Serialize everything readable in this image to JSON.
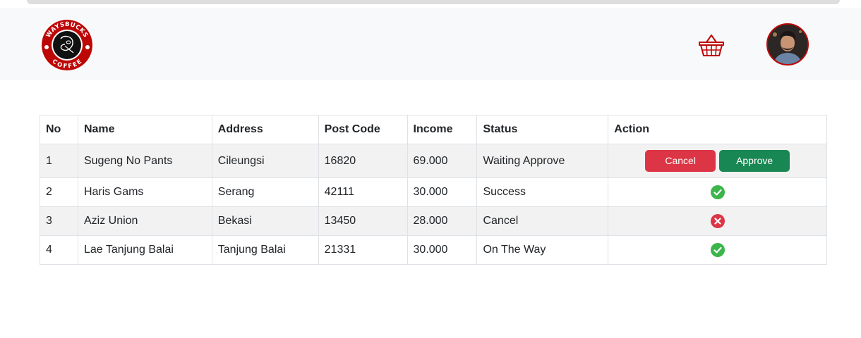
{
  "brand": {
    "logo_alt": "WAYSBUCKS COFFEE",
    "logo_text_top": "WAYSBUCKS",
    "logo_text_bottom": "COFFEE",
    "color": "#bd0707"
  },
  "navbar": {
    "cart_icon": "basket-icon",
    "avatar_icon": "user-avatar"
  },
  "table": {
    "headers": [
      "No",
      "Name",
      "Address",
      "Post Code",
      "Income",
      "Status",
      "Action"
    ],
    "rows": [
      {
        "no": "1",
        "name": "Sugeng No Pants",
        "address": "Cileungsi",
        "post_code": "16820",
        "income": "69.000",
        "status": "Waiting Approve",
        "action": "buttons"
      },
      {
        "no": "2",
        "name": "Haris Gams",
        "address": "Serang",
        "post_code": "42111",
        "income": "30.000",
        "status": "Success",
        "action": "success"
      },
      {
        "no": "3",
        "name": "Aziz Union",
        "address": "Bekasi",
        "post_code": "13450",
        "income": "28.000",
        "status": "Cancel",
        "action": "cancel"
      },
      {
        "no": "4",
        "name": "Lae Tanjung Balai",
        "address": "Tanjung Balai",
        "post_code": "21331",
        "income": "30.000",
        "status": "On The Way",
        "action": "success"
      }
    ],
    "buttons": {
      "cancel": "Cancel",
      "approve": "Approve"
    }
  },
  "colors": {
    "danger": "#dc3545",
    "success_btn": "#198754",
    "success_icon": "#3cb54a"
  }
}
